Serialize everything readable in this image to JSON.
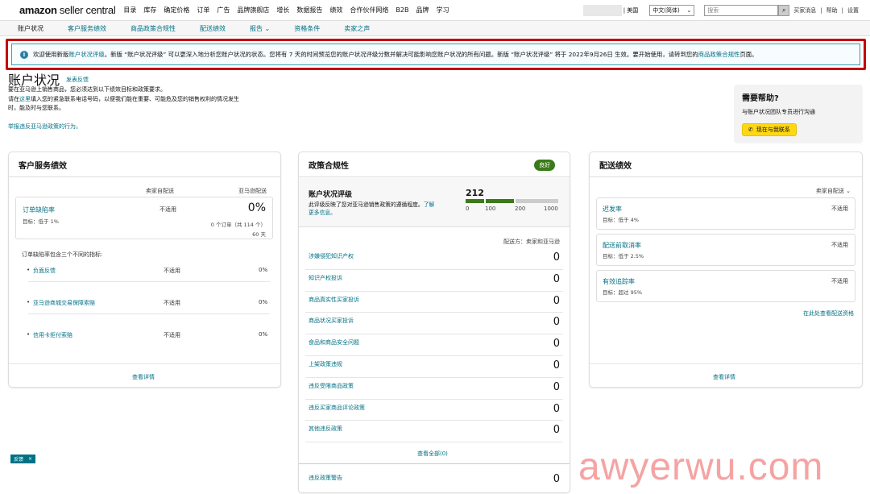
{
  "topnav": {
    "logo_main": "amazon",
    "logo_sub": " seller central",
    "items": [
      "目录",
      "库存",
      "确定价格",
      "订单",
      "广告",
      "品牌旗舰店",
      "增长",
      "数据报告",
      "绩效",
      "合作伙伴网络",
      "B2B",
      "品牌",
      "学习"
    ],
    "market": "| 美国",
    "language": "中文(简体)",
    "search_placeholder": "搜索",
    "links": [
      "买家消息",
      "|",
      "帮助",
      "|",
      "设置"
    ]
  },
  "subnav": [
    "账户状况",
    "客户服务绩效",
    "商品政策合规性",
    "配送绩效",
    "报告",
    "资格条件",
    "卖家之声"
  ],
  "banner": {
    "t1": "欢迎使用新版",
    "l1": "账户状况评级",
    "t2": "。新版 “账户状况评级” 可以更深入地分析您账户状况的状态。您将有 7 天的时间预览您的账户状况评级分数并解决可能影响您账户状况的所有问题。新版 “账户状况评级” 将于 2022年9月26日 生效。要开始使用，请转到您的",
    "l2": "商品政策合规性",
    "t3": "页面。"
  },
  "page": {
    "title": "账户状况",
    "feedback": "发表反馈",
    "intro1": "要在亚马逊上销售商品，您必须达到以下绩效目标和政策要求。",
    "intro2a": "请在",
    "intro2link": "这里",
    "intro2b": "填入您的紧急联系电话号码，以便我们能在重要、可能危及您的销售权利的情况发生",
    "intro3": "时，能及时与您联系。",
    "report": "举报违反亚马逊政策的行为。"
  },
  "help": {
    "title": "需要帮助?",
    "text": "与账户状况团队专员进行沟通",
    "button": "现在与我联系"
  },
  "cs": {
    "title": "客户服务绩效",
    "col1": "卖家自配送",
    "col2": "亚马逊配送",
    "odr_name": "订单缺陷率",
    "odr_target": "目标：低于 1%",
    "odr_na": "不适用",
    "odr_pct": "0%",
    "odr_orders": "0 个订单（共 114 个）",
    "odr_days": "60 天",
    "desc": "订单缺陷率包含三个不同的指标:",
    "subs": [
      {
        "name": "负面反馈",
        "mf": "不适用",
        "fba": "0%"
      },
      {
        "name": "亚马逊商城交易保障索赔",
        "mf": "不适用",
        "fba": "0%"
      },
      {
        "name": "信用卡拒付索赔",
        "mf": "不适用",
        "fba": "0%"
      }
    ],
    "view": "查看详情"
  },
  "pc": {
    "title": "政策合规性",
    "badge": "良好",
    "ahr_title": "账户状况评级",
    "ahr_desc1": "此评级反映了您对亚马逊销售政策的遵循程度。",
    "ahr_link": "了",
    "ahr_link2": "解更多信息。",
    "score": "212",
    "scale": [
      "0",
      "100",
      "200",
      "1000"
    ],
    "fulfill": "配送方：卖家和亚马逊",
    "rows": [
      {
        "label": "涉嫌侵犯知识产权",
        "value": "0"
      },
      {
        "label": "知识产权投诉",
        "value": "0"
      },
      {
        "label": "商品真实性买家投诉",
        "value": "0"
      },
      {
        "label": "商品状况买家投诉",
        "value": "0"
      },
      {
        "label": "食品和商品安全问题",
        "value": "0"
      },
      {
        "label": "上架政策违规",
        "value": "0"
      },
      {
        "label": "违反受限商品政策",
        "value": "0"
      },
      {
        "label": "违反买家商品评论政策",
        "value": "0"
      },
      {
        "label": "其他违反政策",
        "value": "0"
      }
    ],
    "view_all": "查看全部(0)",
    "warn_label": "违反政策警告",
    "warn_value": "0"
  },
  "ship": {
    "title": "配送绩效",
    "filter": "卖家自配送",
    "metrics": [
      {
        "name": "迟发率",
        "target": "目标：低于 4%",
        "value": "不适用"
      },
      {
        "name": "配送前取消率",
        "target": "目标：低于 2.5%",
        "value": "不适用"
      },
      {
        "name": "有效追踪率",
        "target": "目标：超过 95%",
        "value": "不适用"
      }
    ],
    "eligibility": "在此处查看配送资格",
    "view": "查看详情"
  },
  "feedback_tag": "反馈",
  "watermark": "awyerwu.com",
  "colors": {
    "link": "#007185",
    "badge": "#3b7a1a",
    "highlight": "#c40000",
    "button": "#ffd814"
  }
}
